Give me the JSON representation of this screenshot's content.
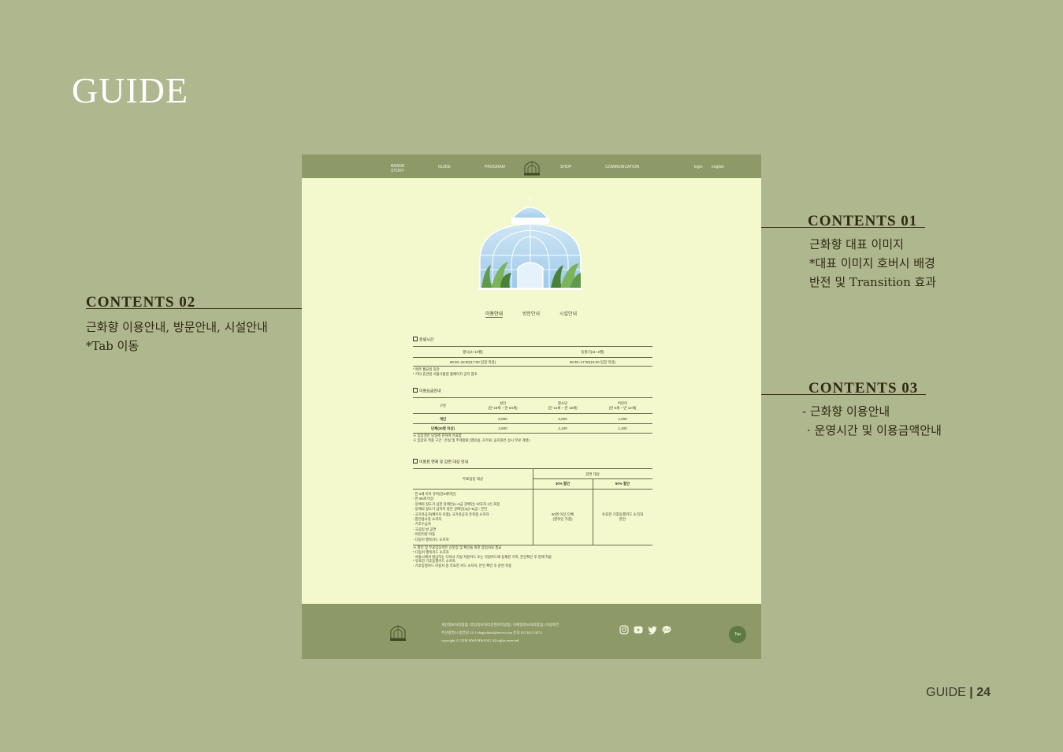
{
  "page": {
    "title": "GUIDE",
    "footer_label": "GUIDE",
    "page_number": "24"
  },
  "annotations": {
    "contents01": {
      "title": "CONTENTS 01",
      "lines": [
        "근화향 대표 이미지",
        "*대표 이미지 호버시 배경",
        "반전 및 Transition 효과"
      ]
    },
    "contents02": {
      "title": "CONTENTS 02",
      "lines": [
        "근화향 이용안내, 방문안내, 시설안내",
        "*Tab 이동"
      ]
    },
    "contents03": {
      "title": "CONTENTS 03",
      "lines": [
        "- 근화향 이용안내",
        "· 운영시간 및 이용금액안내"
      ]
    }
  },
  "mockup": {
    "nav": {
      "items": [
        "BRAND STORY",
        "GUIDE",
        "PROGRAM",
        "SHOP",
        "COMMUNICATION"
      ],
      "login": "login",
      "english": "english"
    },
    "tabs": [
      "이용안내",
      "방문안내",
      "시설안내"
    ],
    "hours": {
      "title": "운영시간",
      "headers": [
        "평시(3~10월)",
        "동절기(11~2월)"
      ],
      "values": [
        "09:30~18:00(17:00 입장 마감)",
        "09:30~17:00(16:00 입장 마감)"
      ],
      "notes": [
        "* 매주 월요일 휴관",
        "* 기타 휴관일 서울식물원 홈페이지 공지 참조"
      ]
    },
    "fees": {
      "title": "이용요금안내",
      "headers": [
        "구분",
        "성인\n(만 19세 ~ 만 64세)",
        "청소년\n(만 13세 ~ 만 18세)",
        "어린이\n(만 6세 ~ 만 12세)"
      ],
      "rows": [
        [
          "개인",
          "5,000",
          "3,000",
          "2,000"
        ],
        [
          "단체(30명 이상)",
          "3,500",
          "2,100",
          "1,400"
        ]
      ],
      "notes": [
        "※ 입장권은 당일에 한하여 유효함",
        "※ 입장료 적용 구간 : 온실 및 주제정원 (열린숲, 호수원, 습지원은 상시 무료 개방)"
      ]
    },
    "discount": {
      "title": "이용료 면제 및 감면 대상 안내",
      "free_header": "무료입장 대상",
      "reduced_header": "감면 대상",
      "sub_headers": [
        "30% 할인",
        "50% 할인"
      ],
      "free_list": [
        "- 만 5세 이하 유아(만6세미만)",
        "- 만 65세 이상",
        "- 장애의 정도가 심한 장애인(1~3급 장애인) :보호자 1인 포함",
        "- 장애의 정도가 심하지 않은 장애인(4급~6급) : 본인",
        "- 국가유공자(배우자 포함), 국가유공자 유족중 소지자",
        "- 참전용사증 소지자",
        "- 기초수급자",
        "- 국공립 날 공연",
        "- 어린이날 아동",
        "- 다둥이 행복카드 소지자"
      ],
      "discount30": "30명 이상 단체\n(명목인 가중)",
      "discount50": "유효한 기후동행카드 소지자\n본인",
      "notes": [
        "※ 할인 및 무료입장객은 신분증 및 확인을 위한 증빙자료 필요",
        "* 다둥이 행복카드 소지자",
        "- 서울시에서 발급하는 다자녀 가정 지원카드 또는 지원카드에 등재된 가족, 본인확인 후 면제 적용",
        "* 유효한 기후동행카드 소지자",
        "- 기후동행카드 이용자 중 유효한 카드 소지자, 본인 확인 후 감면 적용"
      ]
    },
    "footer": {
      "links": "개인정보처리방침 | 영상정보처리운영관리방침 | 이메일정보처리방침 | 이용약관",
      "address": "주산광역시 송연길 12-1 ehagwhhuh@naver.com 문의 0513413-3074",
      "copyright": "copyright © GEM HWA HWANG All rights reserved.",
      "top_label": "Top",
      "social_icons": [
        "instagram-icon",
        "youtube-icon",
        "twitter-icon",
        "kakaotalk-icon"
      ]
    }
  },
  "colors": {
    "bg": "#afb78f",
    "mock_bg": "#f3f9cd",
    "nav_bg": "#8e9968",
    "accent": "#5d7a42"
  }
}
